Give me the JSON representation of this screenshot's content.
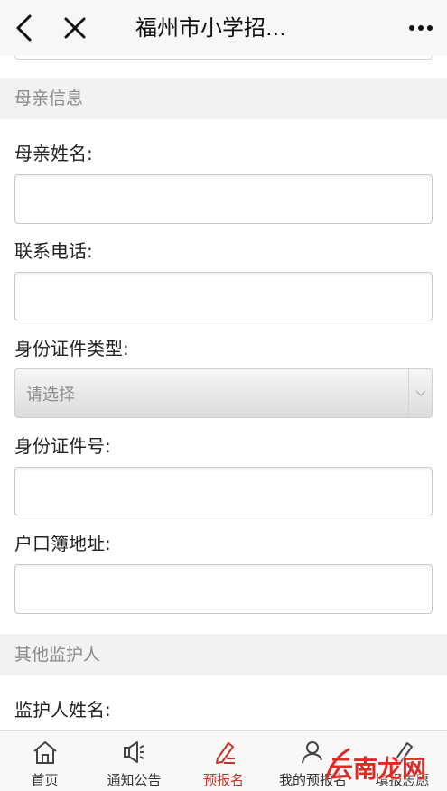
{
  "header": {
    "title": "福州市小学招..."
  },
  "mother_section": {
    "heading": "母亲信息",
    "fields": {
      "name_label": "母亲姓名:",
      "phone_label": "联系电话:",
      "id_type_label": "身份证件类型:",
      "id_type_value": "请选择",
      "id_number_label": "身份证件号:",
      "address_label": "户口簿地址:"
    }
  },
  "guardian_section": {
    "heading": "其他监护人",
    "fields": {
      "name_label": "监护人姓名:"
    }
  },
  "tabbar": {
    "items": [
      {
        "label": "首页",
        "icon": "home-icon"
      },
      {
        "label": "通知公告",
        "icon": "megaphone-icon"
      },
      {
        "label": "预报名",
        "icon": "pen-edit-icon",
        "active": true
      },
      {
        "label": "我的预报名",
        "icon": "user-icon"
      },
      {
        "label": "填报志愿",
        "icon": "pencil-icon"
      }
    ]
  },
  "watermark": {
    "text": "云南龙网"
  },
  "colors": {
    "accent": "#c3342b",
    "section_bg": "#f2f2f2",
    "topbar_bg": "#f7f7f7"
  }
}
